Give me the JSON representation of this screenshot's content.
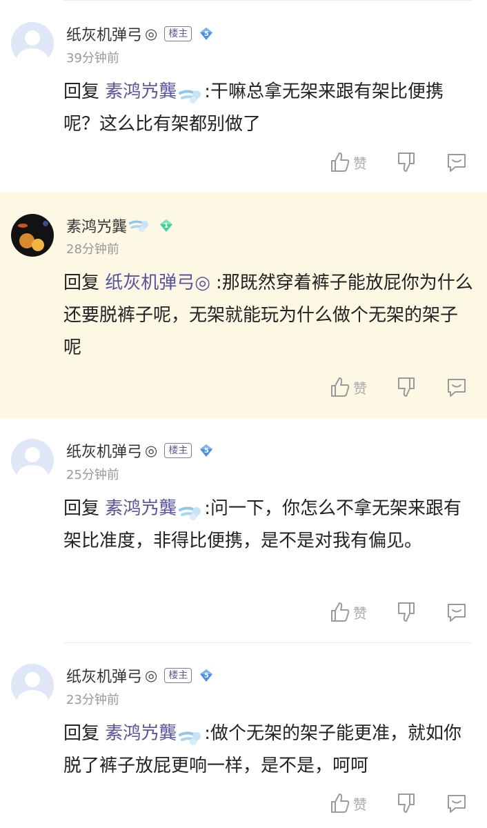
{
  "comments": [
    {
      "user": "纸灰机弹弓",
      "name_mark": "◎",
      "badge": "楼主",
      "level": "5",
      "time": "39分钟前",
      "reply_prefix": "回复 ",
      "reply_to": "素鸿㞧龔",
      "text": ":干嘛总拿无架来跟有架比便携呢？这么比有架都别做了",
      "like_label": "赞"
    },
    {
      "user": "素鸿㞧龔",
      "level": "1",
      "time": "28分钟前",
      "reply_prefix": "回复 ",
      "reply_to": "纸灰机弹弓◎",
      "text": ":那既然穿着裤子能放屁你为什么还要脱裤子呢，无架就能玩为什么做个无架的架子呢",
      "like_label": "赞"
    },
    {
      "user": "纸灰机弹弓",
      "name_mark": "◎",
      "badge": "楼主",
      "level": "5",
      "time": "25分钟前",
      "reply_prefix": "回复 ",
      "reply_to": "素鸿㞧龔",
      "text": ":问一下，你怎么不拿无架来跟有架比准度，非得比便携，是不是对我有偏见。",
      "like_label": "赞"
    },
    {
      "user": "纸灰机弹弓",
      "name_mark": "◎",
      "badge": "楼主",
      "level": "5",
      "time": "23分钟前",
      "reply_prefix": "回复 ",
      "reply_to": "素鸿㞧龔",
      "text": ":做个无架的架子能更准，就如你脱了裤子放屁更响一样，是不是，呵呵",
      "like_label": "赞"
    }
  ],
  "colors": {
    "highlight_bg": "#fcf8e3",
    "reply_name": "#5753a3",
    "level_blue": "#4b8ee8",
    "level_green": "#3ccf9a"
  },
  "icons": {
    "like": "thumbs-up-icon",
    "dislike": "thumbs-down-icon",
    "reply": "chat-bubble-icon",
    "level": "diamond-icon",
    "emoji": "dash-emoji"
  }
}
